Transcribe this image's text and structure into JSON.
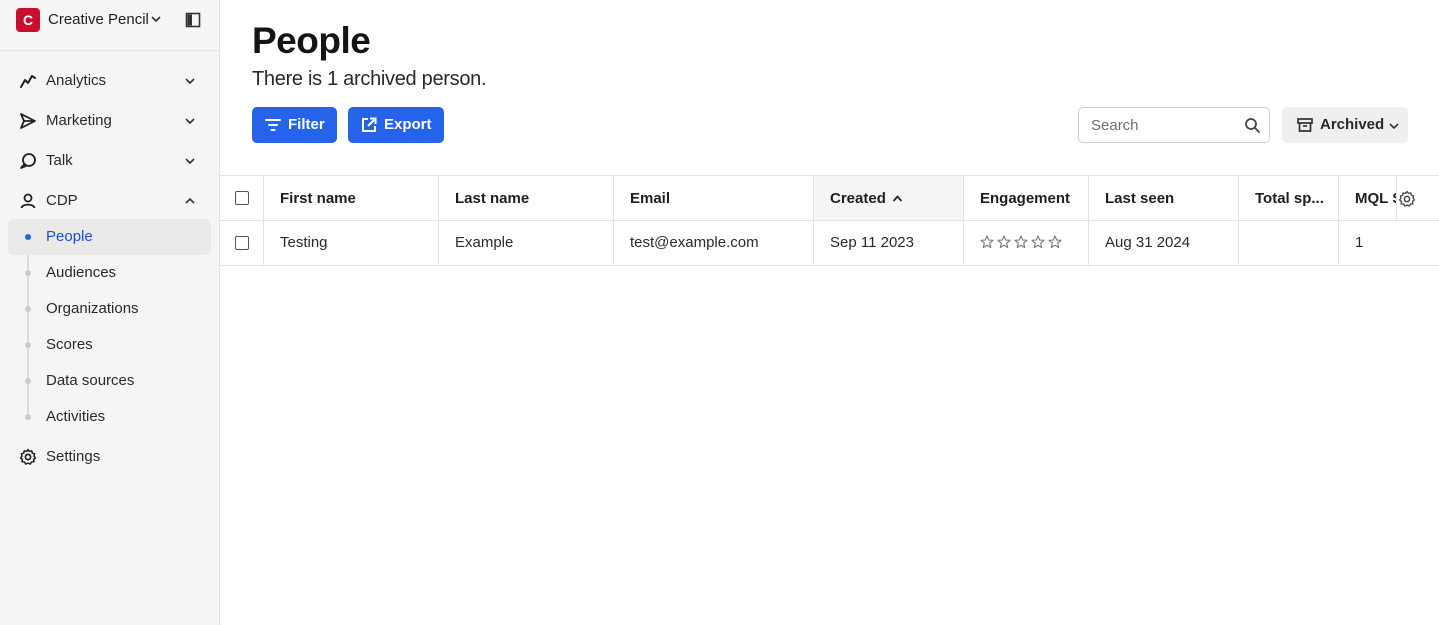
{
  "workspace": {
    "logo_letter": "C",
    "name": "Creative Pencil",
    "brand_color": "#c8102e"
  },
  "nav": {
    "items": [
      {
        "label": "Analytics",
        "icon": "analytics-icon",
        "expanded": false
      },
      {
        "label": "Marketing",
        "icon": "send-icon",
        "expanded": false
      },
      {
        "label": "Talk",
        "icon": "chat-icon",
        "expanded": false
      },
      {
        "label": "CDP",
        "icon": "person-icon",
        "expanded": true
      }
    ],
    "cdp_items": [
      {
        "label": "People",
        "active": true
      },
      {
        "label": "Audiences",
        "active": false
      },
      {
        "label": "Organizations",
        "active": false
      },
      {
        "label": "Scores",
        "active": false
      },
      {
        "label": "Data sources",
        "active": false
      },
      {
        "label": "Activities",
        "active": false
      }
    ],
    "settings_label": "Settings"
  },
  "page": {
    "title": "People",
    "subtitle": "There is 1 archived person."
  },
  "toolbar": {
    "filter_label": "Filter",
    "export_label": "Export",
    "search_placeholder": "Search",
    "archived_label": "Archived",
    "accent_color": "#2563eb"
  },
  "table": {
    "columns": [
      "First name",
      "Last name",
      "Email",
      "Created",
      "Engagement",
      "Last seen",
      "Total sp...",
      "MQL S"
    ],
    "sorted_column": "Created",
    "sort_direction": "ascending",
    "rows": [
      {
        "first_name": "Testing",
        "last_name": "Example",
        "email": "test@example.com",
        "created": "Sep 11 2023",
        "engagement_stars": 0,
        "engagement_max": 5,
        "last_seen": "Aug 31 2024",
        "total_spent": "",
        "mql_score": "1"
      }
    ]
  }
}
